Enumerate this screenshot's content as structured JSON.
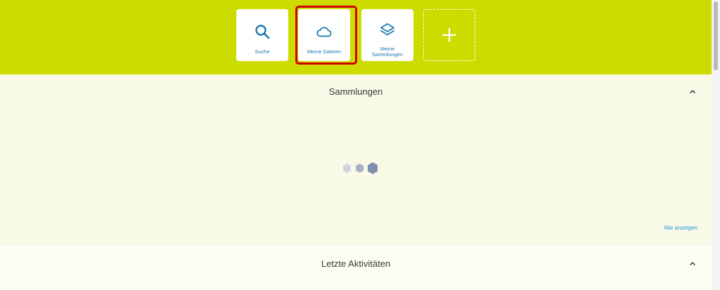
{
  "toolbar": {
    "tiles": [
      {
        "label": "Suche",
        "icon": "search-icon"
      },
      {
        "label": "Meine Dateien",
        "icon": "cloud-icon"
      },
      {
        "label_line1": "Meine",
        "label_line2": "Sammlungen",
        "icon": "layers-icon"
      },
      {
        "label": "",
        "icon": "plus-icon"
      }
    ],
    "accent_color": "#cddc00",
    "icon_color": "#1f78b4"
  },
  "collections": {
    "title": "Sammlungen",
    "show_all_label": "Alle anzeigen",
    "loading": true
  },
  "recent": {
    "title": "Letzte Aktivitäten"
  }
}
